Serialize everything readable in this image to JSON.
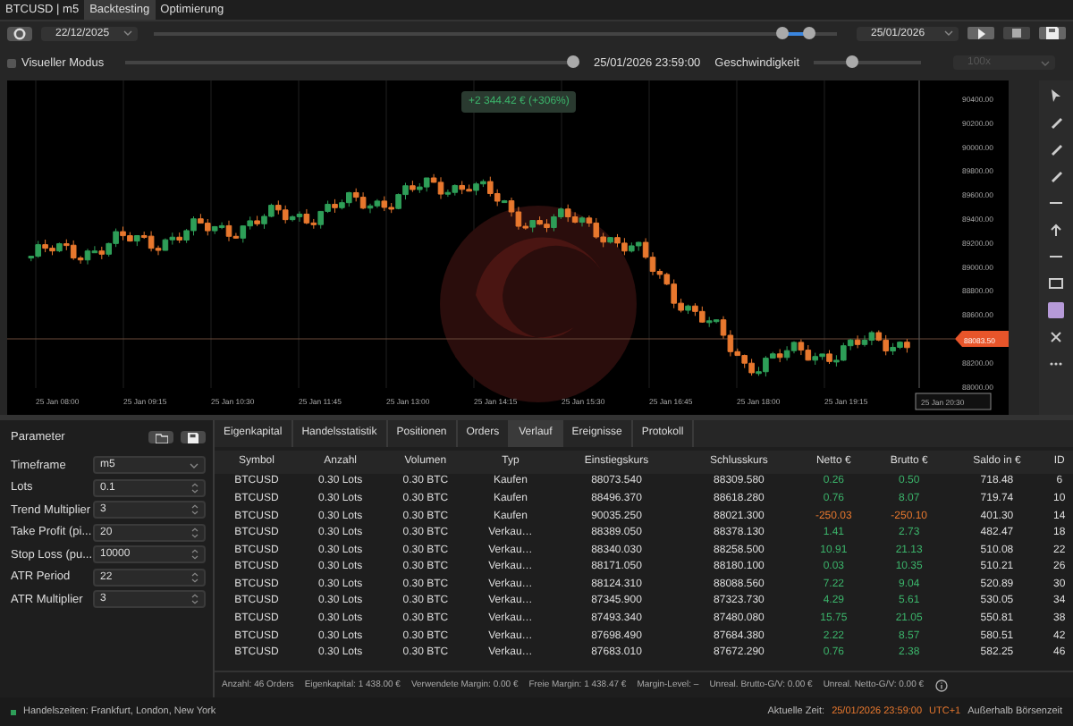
{
  "window": {
    "tabs": [
      {
        "label": "BTCUSD | m5",
        "selected": false
      },
      {
        "label": "Backtesting",
        "selected": true
      },
      {
        "label": "Optimierung",
        "selected": false
      }
    ]
  },
  "period": {
    "start_date": "22/12/2025",
    "range": {
      "start": {
        "level": 0.92
      },
      "end": {
        "level": 0.96
      }
    },
    "end_date": "25/01/2026"
  },
  "replay": {
    "visual_mode": {
      "label": "Visueller Modus",
      "checked": false
    },
    "position": {
      "level": 0.985
    },
    "time": "25/01/2026 23:59:00",
    "speed_label": "Geschwindigkeit",
    "speed": {
      "level": 0.35
    },
    "speed_value": {
      "value": "100x",
      "disabled": true
    }
  },
  "chart": {
    "profit_tag": "+2 344.42 € (+306%)",
    "price_labels": [
      "90400.00",
      "90200.00",
      "90000.00",
      "89800.00",
      "89600.00",
      "89400.00",
      "89200.00",
      "89000.00",
      "88800.00",
      "88600.00",
      "88200.00",
      "88000.00"
    ],
    "current_price": "88083.50",
    "time_labels": [
      "25 Jan 08:00",
      "25 Jan 09:15",
      "25 Jan 10:30",
      "25 Jan 11:45",
      "25 Jan 13:00",
      "25 Jan 14:15",
      "25 Jan 15:30",
      "25 Jan 16:45",
      "25 Jan 18:00",
      "25 Jan 19:15"
    ],
    "cursor_time": "25 Jan 20:30"
  },
  "parameters": {
    "title": "Parameter",
    "items": [
      {
        "label": "Timeframe",
        "value": "m5",
        "kind": "select"
      },
      {
        "label": "Lots",
        "value": "0.1",
        "kind": "spin"
      },
      {
        "label": "Trend Multiplier",
        "value": "3",
        "kind": "spin"
      },
      {
        "label": "Take Profit (pi...",
        "value": "20",
        "kind": "spin"
      },
      {
        "label": "Stop Loss (pu...",
        "value": "10000",
        "kind": "spin"
      },
      {
        "label": "ATR Period",
        "value": "22",
        "kind": "spin"
      },
      {
        "label": "ATR Multiplier",
        "value": "3",
        "kind": "spin"
      }
    ]
  },
  "results": {
    "tabs": [
      {
        "label": "Eigenkapital",
        "selected": false
      },
      {
        "label": "Handelsstatistik",
        "selected": false
      },
      {
        "label": "Positionen",
        "selected": false
      },
      {
        "label": "Orders",
        "selected": false
      },
      {
        "label": "Verlauf",
        "selected": true
      },
      {
        "label": "Ereignisse",
        "selected": false
      },
      {
        "label": "Protokoll",
        "selected": false
      }
    ],
    "columns": [
      "Symbol",
      "Anzahl",
      "Volumen",
      "Typ",
      "Einstiegskurs",
      "Schlusskurs",
      "Netto €",
      "Brutto €",
      "Saldo in €",
      "ID"
    ],
    "rows": [
      {
        "cells": [
          "BTCUSD",
          "0.30 Lots",
          "0.30 BTC",
          "Kaufen",
          "88073.540",
          "88309.580",
          "0.26",
          "0.50",
          "718.48",
          "6"
        ],
        "loss": false
      },
      {
        "cells": [
          "BTCUSD",
          "0.30 Lots",
          "0.30 BTC",
          "Kaufen",
          "88496.370",
          "88618.280",
          "0.76",
          "8.07",
          "719.74",
          "10"
        ],
        "loss": false
      },
      {
        "cells": [
          "BTCUSD",
          "0.30 Lots",
          "0.30 BTC",
          "Kaufen",
          "90035.250",
          "88021.300",
          "-250.03",
          "-250.10",
          "401.30",
          "14"
        ],
        "loss": true
      },
      {
        "cells": [
          "BTCUSD",
          "0.30 Lots",
          "0.30 BTC",
          "Verkau…",
          "88389.050",
          "88378.130",
          "1.41",
          "2.73",
          "482.47",
          "18"
        ],
        "loss": false
      },
      {
        "cells": [
          "BTCUSD",
          "0.30 Lots",
          "0.30 BTC",
          "Verkau…",
          "88340.030",
          "88258.500",
          "10.91",
          "21.13",
          "510.08",
          "22"
        ],
        "loss": false
      },
      {
        "cells": [
          "BTCUSD",
          "0.30 Lots",
          "0.30 BTC",
          "Verkau…",
          "88171.050",
          "88180.100",
          "0.03",
          "10.35",
          "510.21",
          "26"
        ],
        "loss": false
      },
      {
        "cells": [
          "BTCUSD",
          "0.30 Lots",
          "0.30 BTC",
          "Verkau…",
          "88124.310",
          "88088.560",
          "7.22",
          "9.04",
          "520.89",
          "30"
        ],
        "loss": false
      },
      {
        "cells": [
          "BTCUSD",
          "0.30 Lots",
          "0.30 BTC",
          "Verkau…",
          "87345.900",
          "87323.730",
          "4.29",
          "5.61",
          "530.05",
          "34"
        ],
        "loss": false
      },
      {
        "cells": [
          "BTCUSD",
          "0.30 Lots",
          "0.30 BTC",
          "Verkau…",
          "87493.340",
          "87480.080",
          "15.75",
          "21.05",
          "550.81",
          "38"
        ],
        "loss": false
      },
      {
        "cells": [
          "BTCUSD",
          "0.30 Lots",
          "0.30 BTC",
          "Verkau…",
          "87698.490",
          "87684.380",
          "2.22",
          "8.57",
          "580.51",
          "42"
        ],
        "loss": false
      },
      {
        "cells": [
          "BTCUSD",
          "0.30 Lots",
          "0.30 BTC",
          "Verkau…",
          "87683.010",
          "87672.290",
          "0.76",
          "2.38",
          "582.25",
          "46"
        ],
        "loss": false
      }
    ],
    "summary": [
      "Anzahl: 46 Orders",
      "Eigenkapital: 1 438.00 €",
      "Verwendete Margin: 0.00 €",
      "Freie Margin: 1 438.47 €",
      "Margin-Level: –",
      "Unreal. Brutto-G/V: 0.00 €",
      "Unreal. Netto-G/V: 0.00 €"
    ]
  },
  "status_bar": {
    "sessions": "Handelszeiten: Frankfurt, London, New York",
    "time_label": "Aktuelle Zeit:",
    "time": "25/01/2026 23:59:00",
    "zone": "UTC+1",
    "market": "Außerhalb Börsenzeit"
  }
}
